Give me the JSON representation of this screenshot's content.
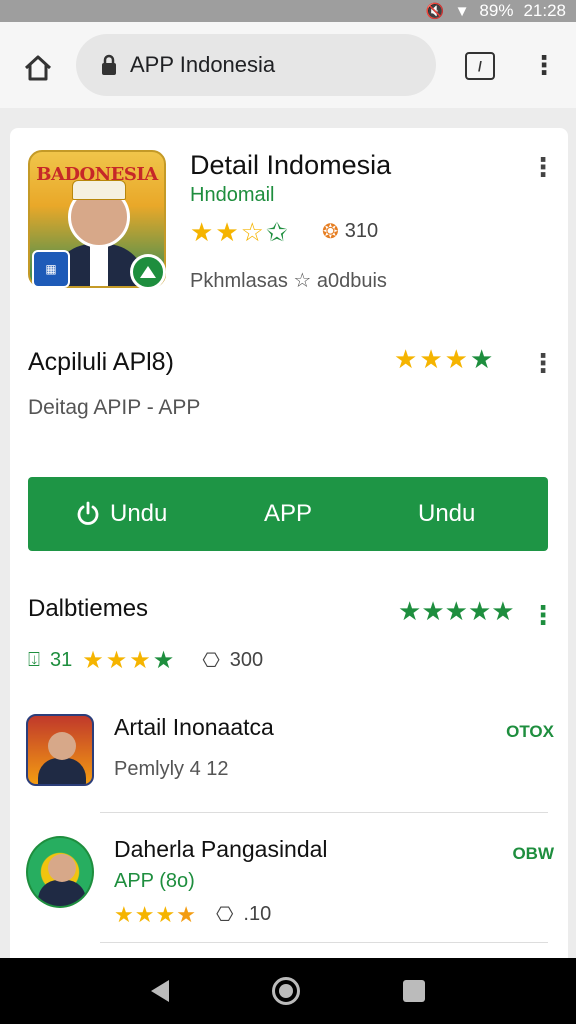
{
  "status_bar": {
    "icons": [
      "mute-icon",
      "wifi-icon"
    ],
    "battery": "89%",
    "time": "21:28"
  },
  "browser": {
    "url": "APP Indonesia"
  },
  "app": {
    "title": "Detail Indomesia",
    "icon_text": "BADONESIA",
    "developer": "Hndomail",
    "rating_count": "310",
    "meta_label": "Pkhmlasas",
    "meta_extra": "a0dbuis"
  },
  "section1": {
    "title": "Acpiluli APl8)",
    "subtitle": "Deitag APIP - APP"
  },
  "install_button": {
    "label_1": "Undu",
    "label_2": "APP",
    "label_3": "Undu"
  },
  "section2": {
    "title": "Dalbtiemes",
    "count_1": "31",
    "count_2": "300"
  },
  "list": [
    {
      "title": "Artail Inonaatca",
      "subtitle": "Pemlyly 4 12",
      "side": "OTOX"
    },
    {
      "title": "Daherla Pangasindal",
      "subtitle": "APP (8o)",
      "side": "OBW",
      "count": ".10"
    }
  ],
  "colors": {
    "accent_green": "#1e9545",
    "star_yellow": "#f5b400"
  }
}
